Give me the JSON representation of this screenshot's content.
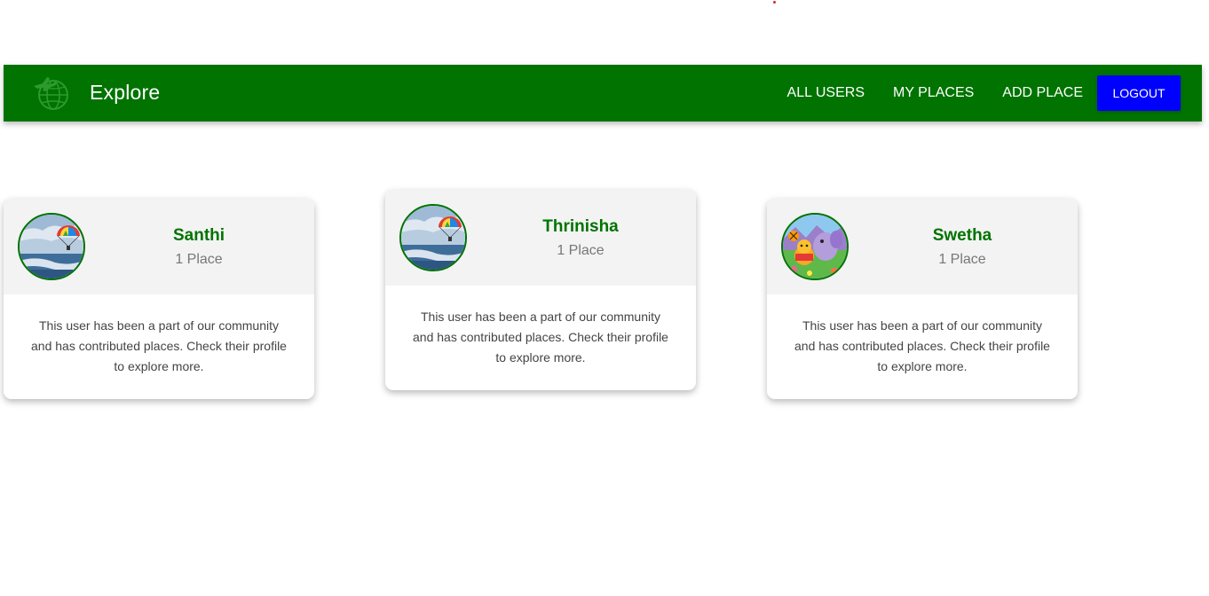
{
  "header": {
    "title": "Explore",
    "logo_icon": "globe-airplane-icon",
    "nav": [
      {
        "label": "ALL USERS"
      },
      {
        "label": "MY PLACES"
      },
      {
        "label": "ADD PLACE"
      }
    ],
    "logout_label": "LOGOUT",
    "colors": {
      "bar": "#007300",
      "logout": "#0000ff"
    }
  },
  "users": [
    {
      "name": "Santhi",
      "places": "1 Place",
      "description": "This user has been a part of our community and has contributed places. Check their profile to explore more.",
      "avatar_image": "parasailing-over-sea"
    },
    {
      "name": "Thrinisha",
      "places": "1 Place",
      "description": "This user has been a part of our community and has contributed places. Check their profile to explore more.",
      "avatar_image": "parasailing-over-sea"
    },
    {
      "name": "Swetha",
      "places": "1 Place",
      "description": "This user has been a part of our community and has contributed places. Check their profile to explore more.",
      "avatar_image": "cartoon-characters"
    }
  ]
}
